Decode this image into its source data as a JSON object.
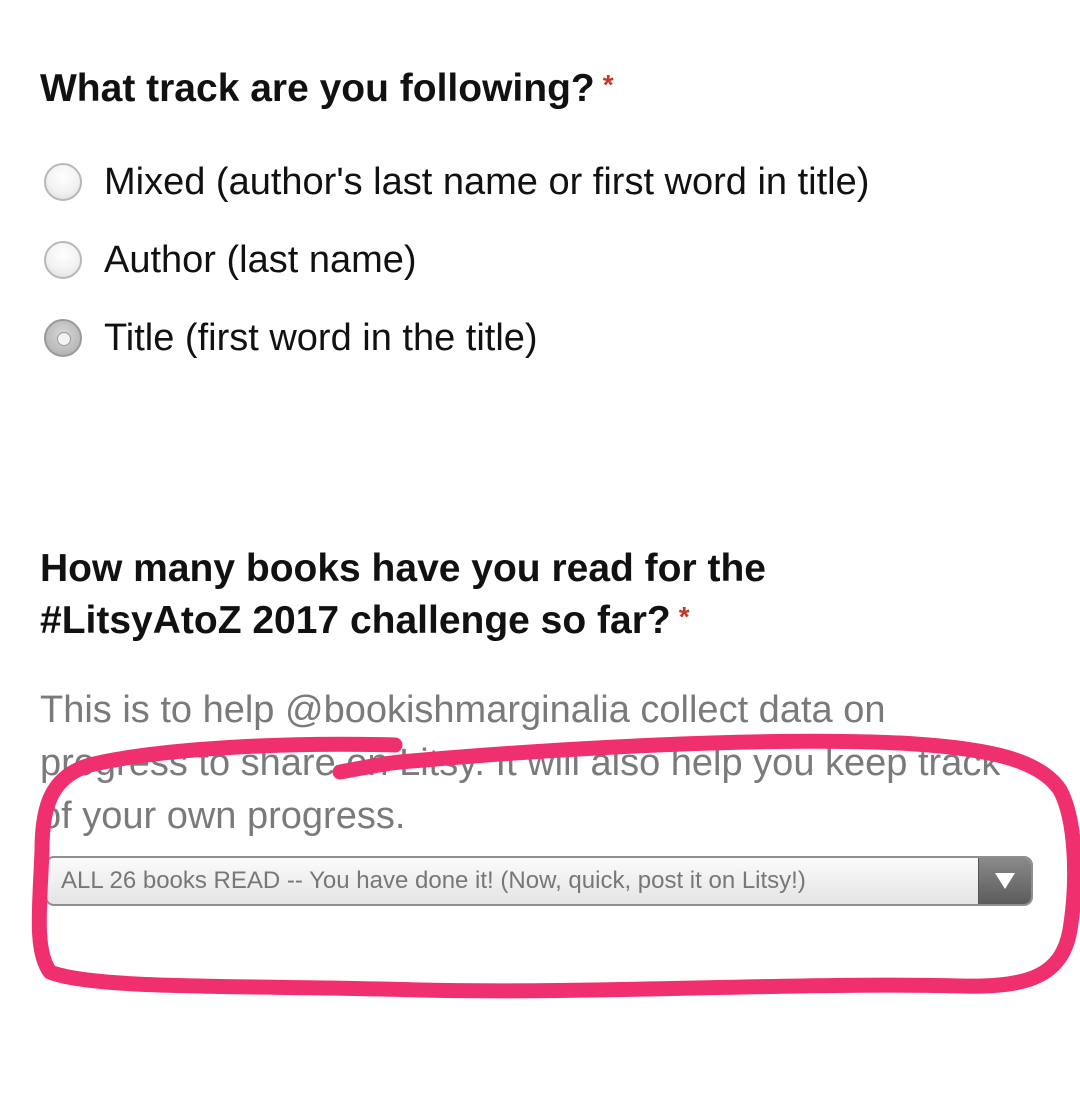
{
  "question_track": {
    "title": "What track are you following?",
    "required_mark": "*",
    "options": [
      {
        "label": "Mixed (author's last name or first word in title)",
        "selected": false
      },
      {
        "label": "Author (last name)",
        "selected": false
      },
      {
        "label": "Title (first word in the title)",
        "selected": true
      }
    ]
  },
  "question_books": {
    "title_line1": "How many books have you read for the",
    "title_line2": "#LitsyAtoZ 2017 challenge so far?",
    "required_mark": "*",
    "help_text": "This is to help @bookishmarginalia collect data on progress to share on Litsy. It will also help you keep track of your own progress.",
    "select_value": "ALL 26 books READ -- You have done it! (Now, quick, post it on Litsy!)"
  },
  "annotation": {
    "color": "#f0306e",
    "icon": "hand-drawn-circle-highlight"
  },
  "colors": {
    "required": "#c0392b",
    "help_text": "#7a7a7a"
  }
}
